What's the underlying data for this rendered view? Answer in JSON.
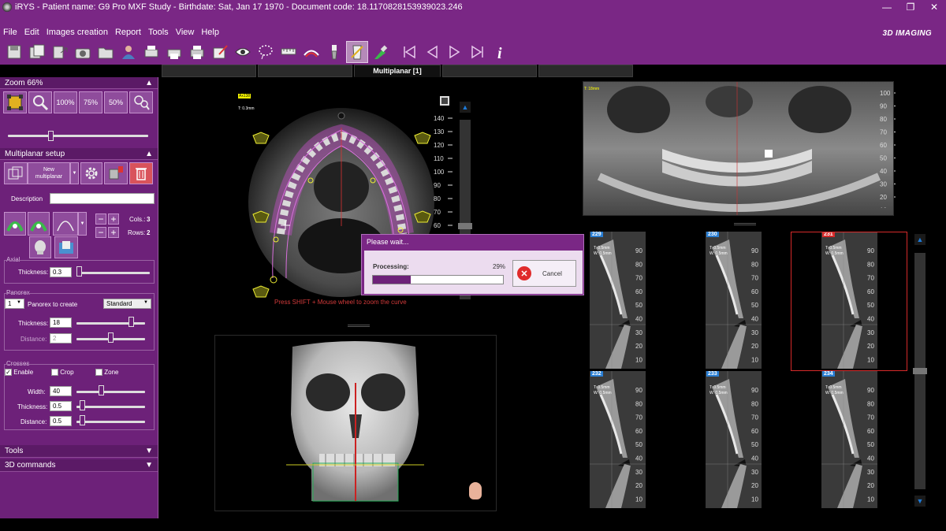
{
  "window": {
    "title": "iRYS - Patient name: G9 Pro MXF Study - Birthdate: Sat, Jan 17 1970 - Document code: 18.1170828153939023.246",
    "controls": [
      "—",
      "❐",
      "✕"
    ]
  },
  "menu": {
    "items": [
      "File",
      "Edit",
      "Images creation",
      "Report",
      "Tools",
      "View",
      "Help"
    ],
    "brand": "3D IMAGING"
  },
  "toolbar": {
    "icons": [
      "save-icon",
      "save-copy-icon",
      "export-icon",
      "camera-icon",
      "folder-icon",
      "patient-icon",
      "print-icon",
      "print-preview-icon",
      "printer-icon",
      "edit-draw-icon",
      "eye-icon",
      "lasso-icon",
      "measure-ruler-icon",
      "nerve-icon",
      "implant-icon",
      "teeth-select-icon",
      "brush-icon",
      "first-icon",
      "previous-icon",
      "play-icon",
      "last-icon",
      "info-icon"
    ],
    "active_index": 15
  },
  "tabs": {
    "items": [
      "",
      "",
      "Multiplanar [1]",
      "",
      ""
    ],
    "active_index": 2
  },
  "left": {
    "zoom": {
      "header": "Zoom 66%",
      "b100": "100%",
      "b75": "75%",
      "b50": "50%",
      "level_pct": 30
    },
    "mpr": {
      "header": "Multiplanar setup",
      "new_btn": "New\nmultiplanar",
      "description_label": "Description",
      "description_value": "",
      "cols_label": "Cols.:",
      "cols_value": "3",
      "rows_label": "Rows:",
      "rows_value": "2",
      "minus": "−",
      "plus": "+"
    },
    "axial": {
      "title": "Axial",
      "thickness_label": "Thickness:",
      "thickness_value": "0.3",
      "thickness_level": 0
    },
    "panorex": {
      "title": "Panorex",
      "count": "1",
      "create_label": "Panorex to create",
      "type": "Standard",
      "thickness_label": "Thickness:",
      "thickness_value": "18",
      "thickness_level": 82,
      "distance_label": "Distance:",
      "distance_value": "2",
      "distance_level": 50
    },
    "crosses": {
      "title": "Crosses",
      "enable": "Enable",
      "enable_checked": true,
      "crop": "Crop",
      "zone": "Zone",
      "width_label": "Width:",
      "width_value": "40",
      "width_level": 35,
      "thickness_label": "Thickness:",
      "thickness_value": "0.5",
      "thickness_level": 5,
      "distance_label": "Distance:",
      "distance_value": "0.5",
      "distance_level": 5
    },
    "tools_header": "Tools",
    "commands_header": "3D commands"
  },
  "axial_view": {
    "label_yellow": "Ax138",
    "label_t": "T: 0.3mm",
    "ruler": [
      "140",
      "130",
      "120",
      "110",
      "100",
      "90",
      "80",
      "70",
      "60"
    ],
    "hint": "Press SHIFT + Mouse wheel to zoom the curve"
  },
  "pano_view": {
    "label_t": "T: 18mm",
    "ruler": [
      "100",
      "90",
      "80",
      "70",
      "60",
      "50",
      "40",
      "30",
      "20",
      "10"
    ]
  },
  "cross_sections": {
    "ruler": [
      "90",
      "80",
      "70",
      "60",
      "50",
      "40",
      "30",
      "20",
      "10"
    ],
    "tile_t": "T: 0.5mm",
    "tile_w": "W: 0.5mm",
    "slices": [
      {
        "num": "229",
        "color": "#2a7fd4"
      },
      {
        "num": "230",
        "color": "#2a7fd4"
      },
      {
        "num": "231",
        "color": "#d62a2a"
      },
      {
        "num": "232",
        "color": "#2a7fd4"
      },
      {
        "num": "233",
        "color": "#2a7fd4"
      },
      {
        "num": "234",
        "color": "#2a7fd4"
      }
    ],
    "selected_index": 2
  },
  "dialog": {
    "title": "Please wait...",
    "processing_label": "Processing:",
    "percent_text": "29%",
    "progress_fraction": 0.29,
    "cancel_label": "Cancel"
  },
  "colors": {
    "chrome": "#7a2785",
    "panel": "#6d2179",
    "curve": "#c34fc8",
    "accent_blue": "#1e7ad8",
    "selected_red": "#d62a2a"
  }
}
